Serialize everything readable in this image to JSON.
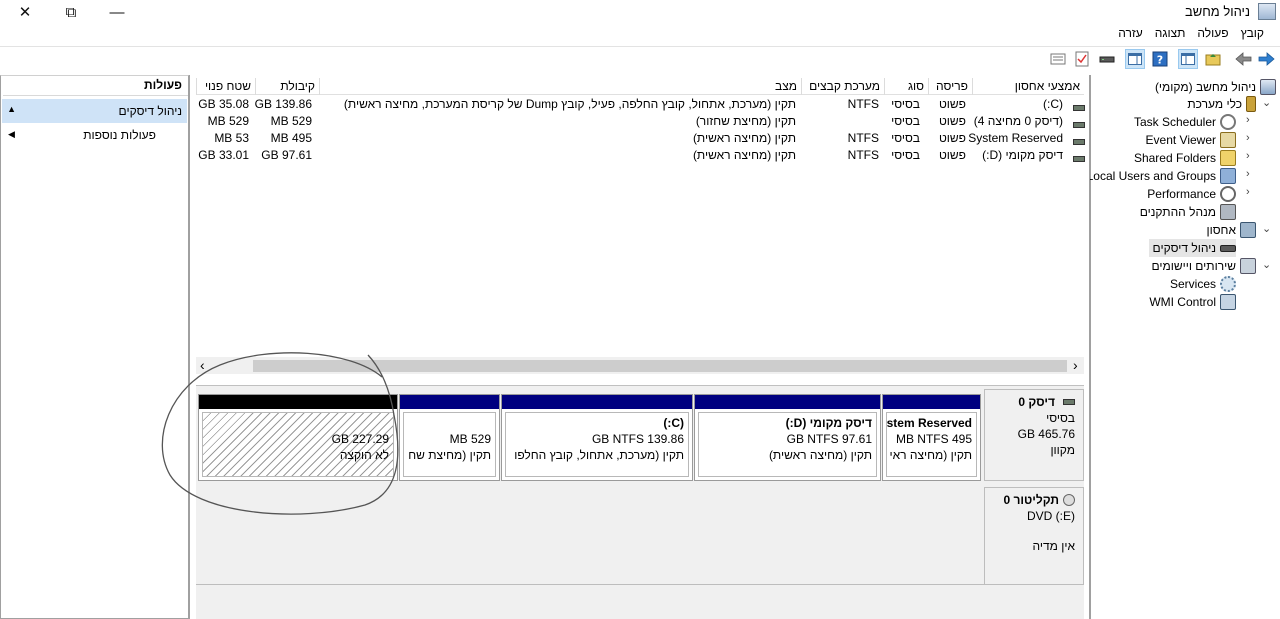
{
  "window": {
    "title": "ניהול מחשב",
    "controls": {
      "close": "✕",
      "restore": "⧉",
      "minimize": "—"
    }
  },
  "menu": [
    "קובץ",
    "פעולה",
    "תצוגה",
    "עזרה"
  ],
  "actions_pane": {
    "title": "פעולות",
    "items": [
      {
        "label": "ניהול דיסקים",
        "arrow": "▲"
      },
      {
        "label": "פעולות נוספות",
        "arrow": "◀"
      }
    ]
  },
  "tree": {
    "items": [
      {
        "label": "ניהול מחשב (מקומי)",
        "icon": "computer-management-icon"
      },
      {
        "label": "כלי מערכת",
        "icon": "tools-icon"
      },
      {
        "label": "Task Scheduler",
        "icon": "clock-icon"
      },
      {
        "label": "Event Viewer",
        "icon": "event-viewer-icon"
      },
      {
        "label": "Shared Folders",
        "icon": "shared-folders-icon"
      },
      {
        "label": "Local Users and Groups",
        "icon": "users-icon"
      },
      {
        "label": "Performance",
        "icon": "performance-icon"
      },
      {
        "label": "מנהל ההתקנים",
        "icon": "device-manager-icon"
      },
      {
        "label": "אחסון",
        "icon": "storage-icon"
      },
      {
        "label": "ניהול דיסקים",
        "icon": "disk-management-icon"
      },
      {
        "label": "שירותים ויישומים",
        "icon": "services-apps-icon"
      },
      {
        "label": "Services",
        "icon": "services-icon"
      },
      {
        "label": "WMI Control",
        "icon": "wmi-icon"
      }
    ],
    "chevrons": {
      "collapsed": "›",
      "expanded": "⌄"
    }
  },
  "volume_list": {
    "columns": [
      "אמצעי אחסון",
      "פריסה",
      "סוג",
      "מערכת קבצים",
      "מצב",
      "קיבולת",
      "שטח פנוי"
    ],
    "rows": [
      {
        "volume": "(C:)",
        "layout": "פשוט",
        "type": "בסיסי",
        "fs": "NTFS",
        "status": "תקין (מערכת, אתחול, קובץ החלפה, פעיל, קובץ Dump של קריסת המערכת, מחיצה ראשית)",
        "capacity": "GB 139.86",
        "free": "GB 35.08"
      },
      {
        "volume": "(דיסק 0 מחיצה 4)",
        "layout": "פשוט",
        "type": "בסיסי",
        "fs": "",
        "status": "תקין (מחיצת שחזור)",
        "capacity": "MB 529",
        "free": "MB 529"
      },
      {
        "volume": "System Reserved",
        "layout": "פשוט",
        "type": "בסיסי",
        "fs": "NTFS",
        "status": "תקין (מחיצה ראשית)",
        "capacity": "MB 495",
        "free": "MB 53"
      },
      {
        "volume": "דיסק מקומי (D:)",
        "layout": "פשוט",
        "type": "בסיסי",
        "fs": "NTFS",
        "status": "תקין (מחיצה ראשית)",
        "capacity": "GB 97.61",
        "free": "GB 33.01"
      }
    ]
  },
  "disks": [
    {
      "name": "דיסק 0",
      "type": "בסיסי",
      "size": "GB 465.76",
      "state": "מקוון",
      "partitions": [
        {
          "title": "stem Reserved",
          "size": "MB NTFS 495",
          "status": "תקין (מחיצה ראי"
        },
        {
          "title": "דיסק מקומי  (D:)",
          "size": "GB NTFS 97.61",
          "status": "תקין (מחיצה ראשית)"
        },
        {
          "title": "(C:)",
          "size": "GB NTFS 139.86",
          "status": "תקין (מערכת, אתחול, קובץ החלפו"
        },
        {
          "title": "",
          "size": "MB 529",
          "status": "תקין (מחיצת שח"
        },
        {
          "title": "",
          "size": "GB 227.29",
          "status": "לא הוקצה"
        }
      ]
    },
    {
      "name": "תקליטור 0",
      "type": "(E:) DVD",
      "state": "אין מדיה"
    }
  ],
  "scrollbar": {
    "left_arrow": "‹",
    "right_arrow": "›"
  }
}
